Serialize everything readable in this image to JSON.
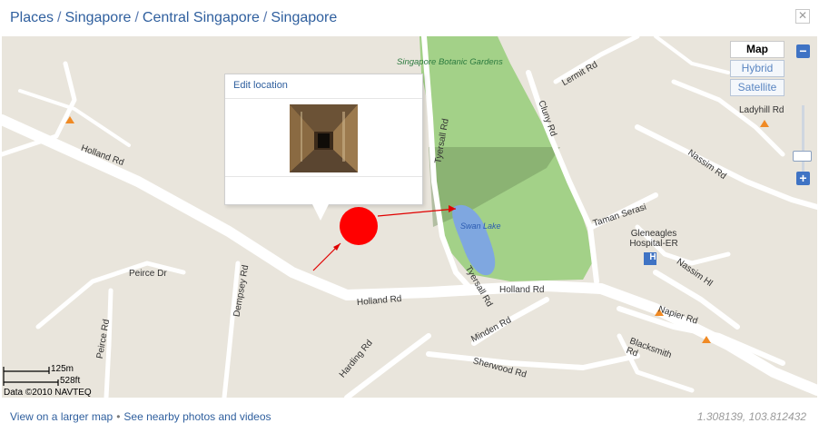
{
  "breadcrumb": {
    "items": [
      "Places",
      "Singapore",
      "Central Singapore",
      "Singapore"
    ],
    "separator": "/"
  },
  "close_icon": "✕",
  "map": {
    "map_types": {
      "map": "Map",
      "hybrid": "Hybrid",
      "satellite": "Satellite",
      "selected": "Map"
    },
    "zoom": {
      "in_label": "+",
      "out_label": "−"
    },
    "labels": {
      "park": "Singapore Botanic Gardens",
      "lake": "Swan Lake",
      "holland_rd_1": "Holland Rd",
      "holland_rd_2": "Holland Rd",
      "holland_rd_3": "Holland Rd",
      "peirce_dr": "Peirce Dr",
      "peirce_rd": "Peirce Rd",
      "dempsey_rd": "Dempsey Rd",
      "tyersall_rd_1": "Tyersall Rd",
      "tyersall_rd_2": "Tyersall Rd",
      "cluny_rd": "Cluny Rd",
      "lermit_rd": "Lermit Rd",
      "ladyhill_rd": "Ladyhill Rd",
      "nassim_rd": "Nassim Rd",
      "taman_serasi": "Taman Serasi",
      "gleneagles": "Gleneagles Hospital-ER",
      "nassim_hl": "Nassim Hl",
      "napier_rd": "Napier Rd",
      "minden_rd": "Minden Rd",
      "harding_rd": "Harding Rd",
      "sherwood_rd": "Sherwood Rd",
      "blacksmith_rd": "Blacksmith Rd"
    },
    "popup": {
      "edit_label": "Edit location",
      "photo_icon": "photo-thumbnail"
    },
    "scale": {
      "metric": "125m",
      "imperial": "528ft"
    },
    "attribution": "Data ©2010 NAVTEQ",
    "hospital_icon": "H",
    "marker_color": "#ff0000",
    "arrow_color": "#e00000"
  },
  "footer": {
    "larger_map": "View on a larger map",
    "separator": "•",
    "nearby": "See nearby photos and videos",
    "coordinates": "1.308139, 103.812432"
  },
  "colors": {
    "link": "#2f5f9e",
    "map_bg": "#e9e5dc",
    "park": "#a3d188",
    "water": "#7fa7e0",
    "road": "#ffffff",
    "zoom_button": "#3f73c4"
  }
}
